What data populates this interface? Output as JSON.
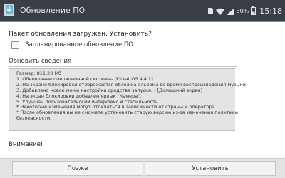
{
  "titlebar": {
    "icon": "software-update-icon",
    "title": "Обновление ПО"
  },
  "statusbar": {
    "icons": [
      "sd-card-icon",
      "wifi-icon",
      "signal-icon",
      "battery-icon"
    ],
    "battery_percent": "30%",
    "time": "15:18"
  },
  "dialog": {
    "prompt": "Пакет обновления загружен. Установить?",
    "scheduled_checkbox": {
      "label": "Запланированное обновление ПО",
      "checked": false
    },
    "details_title": "Обновить сведения",
    "details_lines": [
      "Размер: 811.20 Мб",
      "1. Обновление операционной системы- [KitKat OS 4.4.2]",
      "2. На экране блокировки отображается обложка альбома во время воспроизведения музыки.",
      "3. Добавлено новое меню настройки средства запуска. - [Домашний экран]",
      "4. На экран блокировки добавлен ярлык \"Камера\".",
      "5. Улучшен пользовательский интерфейс и стабильность",
      "* Некоторые изменения могут отличаться в зависимости от страны и оператора.",
      "* После обновления вы не сможете установить старую версию из-за изменения политики",
      "безопасности."
    ],
    "warning": "Внимание!"
  },
  "buttons": {
    "later": "Позже",
    "install": "Установить"
  },
  "colors": {
    "titlebar_bg": "#3a3f45",
    "accent": "#2aa4d6",
    "details_bg": "#e4e4e4",
    "buttonbar_bg": "#e3e3e3"
  }
}
